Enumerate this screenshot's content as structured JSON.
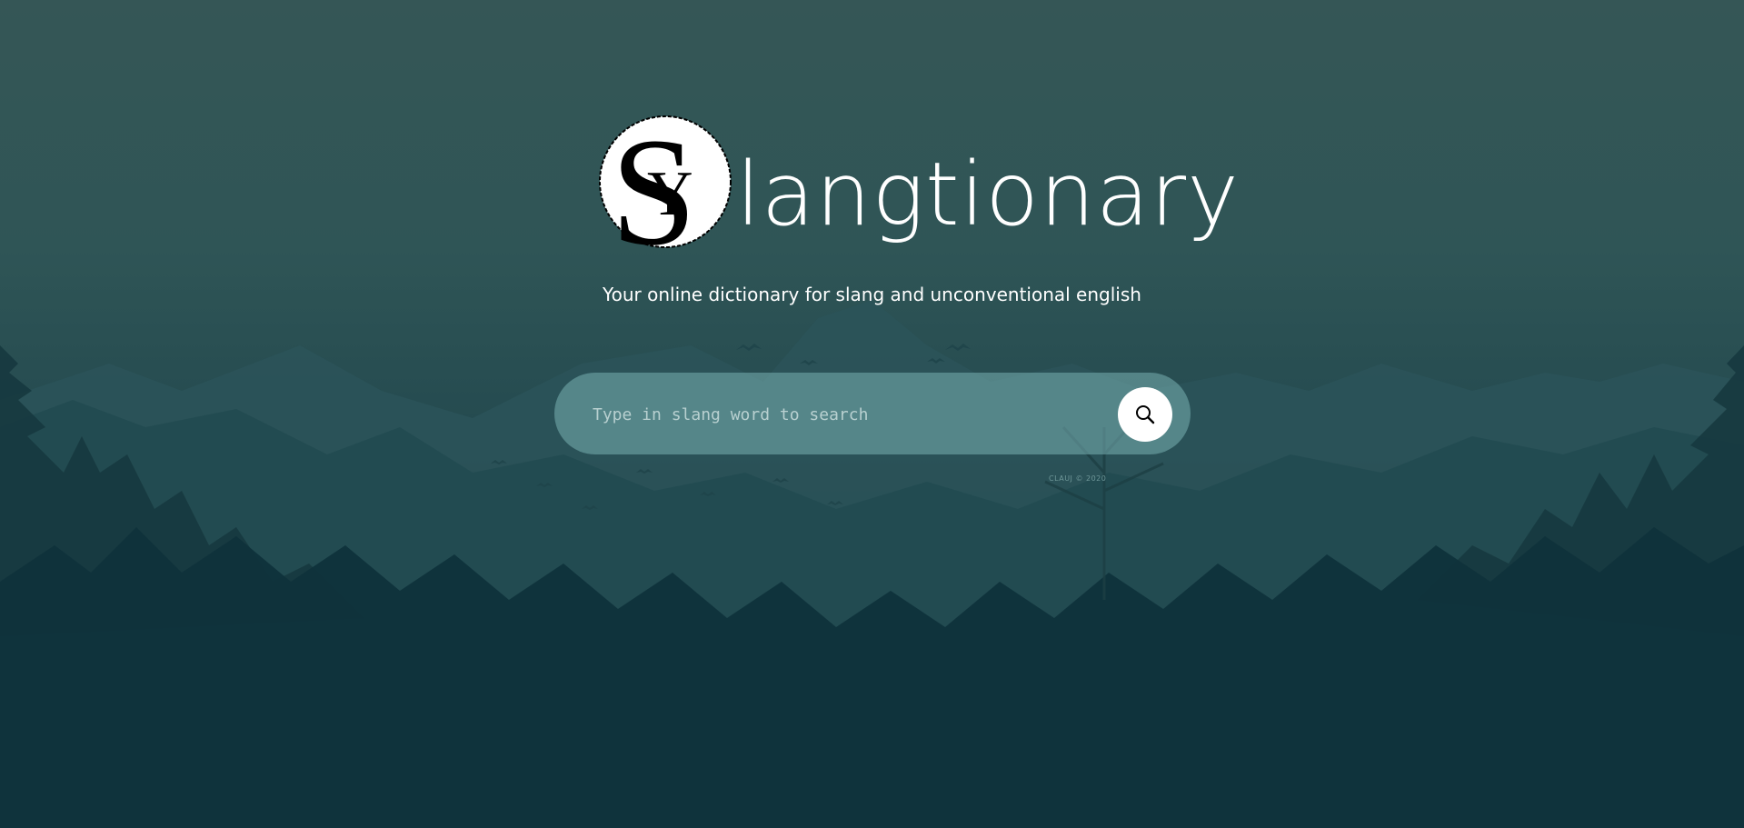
{
  "logo": {
    "emblem_letters": "SY",
    "wordmark": "langtionary"
  },
  "tagline": "Your online dictionary for slang and unconventional english",
  "search": {
    "placeholder": "Type in slang word to search",
    "value": "",
    "button_icon": "search-icon"
  },
  "footer": {
    "note": "CLAUJ © 2020"
  },
  "colors": {
    "background_top": "#355656",
    "background_bottom": "#0f303b",
    "text": "#ffffff",
    "search_bar": "#78b0b2"
  }
}
